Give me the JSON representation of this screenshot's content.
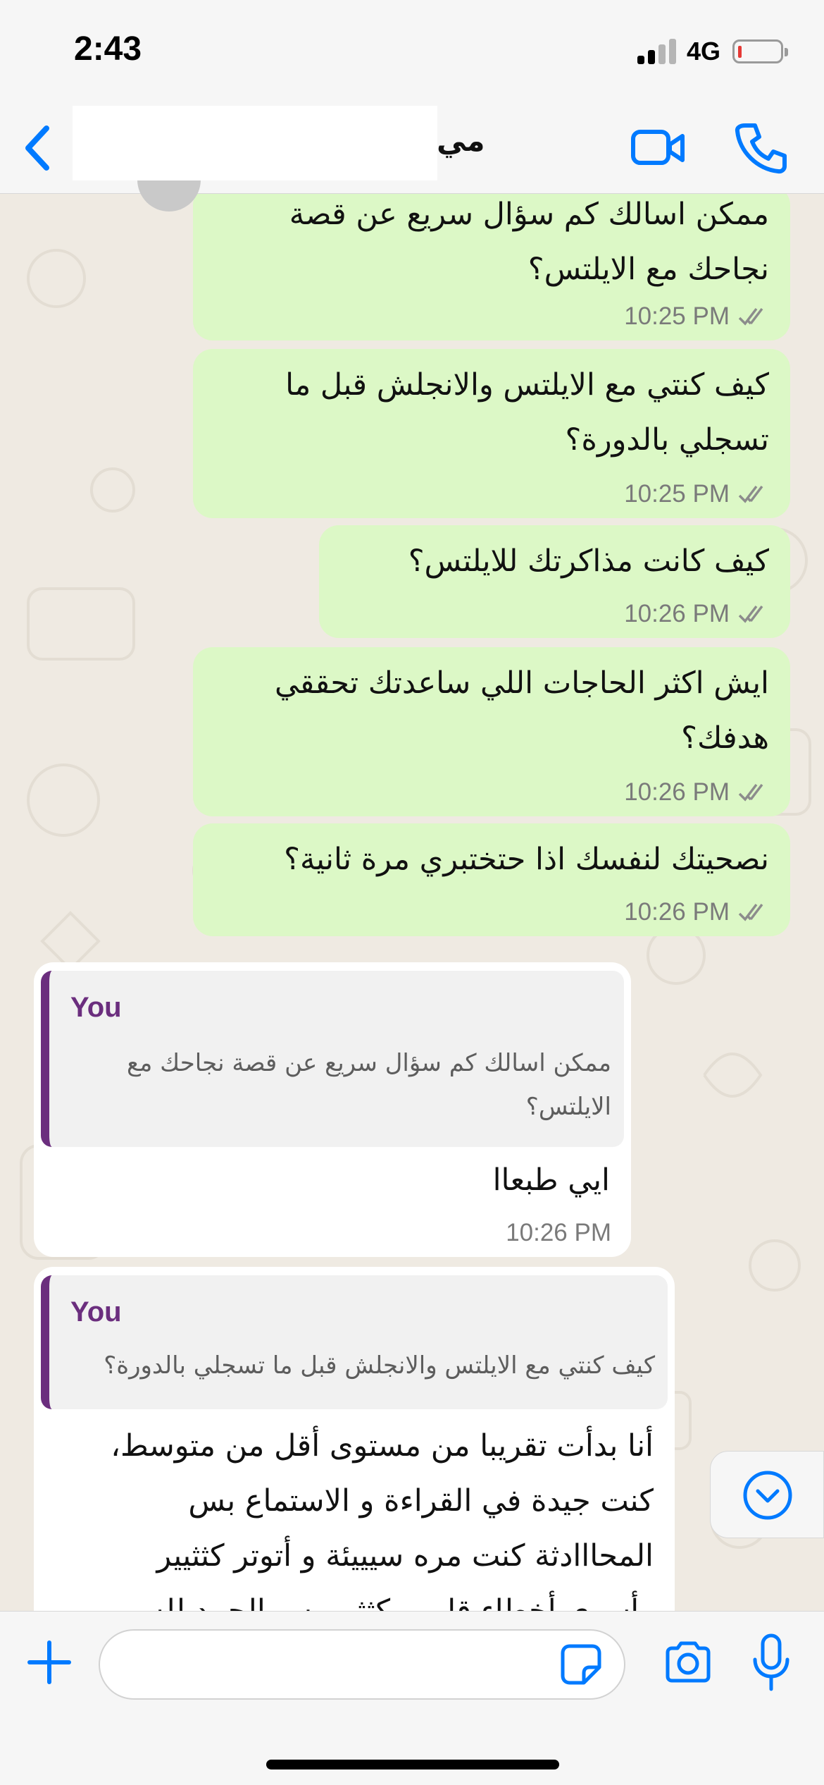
{
  "status_bar": {
    "time": "2:43",
    "network": "4G",
    "battery_level": 0.08
  },
  "header": {
    "contact_name": "مي",
    "accent_color": "#007aff"
  },
  "messages": [
    {
      "direction": "outgoing",
      "lines": [
        "ممكن اسالك كم سؤال سريع عن قصة",
        "نجاحك مع الايلتس؟"
      ],
      "time": "10:25 PM",
      "status": "read"
    },
    {
      "direction": "outgoing",
      "lines": [
        "كيف كنتي مع الايلتس والانجلش قبل ما",
        "تسجلي بالدورة؟"
      ],
      "time": "10:25 PM",
      "status": "read"
    },
    {
      "direction": "outgoing",
      "lines": [
        "كيف كانت مذاكرتك للايلتس؟"
      ],
      "time": "10:26 PM",
      "status": "read"
    },
    {
      "direction": "outgoing",
      "lines": [
        "ايش اكثر الحاجات اللي ساعدتك تحققي",
        "هدفك؟"
      ],
      "time": "10:26 PM",
      "status": "read"
    },
    {
      "direction": "outgoing",
      "lines": [
        "نصحيتك لنفسك اذا حتختبري مرة ثانية؟"
      ],
      "time": "10:26 PM",
      "status": "read"
    },
    {
      "direction": "incoming",
      "reply_to": {
        "author": "You",
        "lines": [
          "ممكن اسالك كم سؤال سريع عن قصة نجاحك مع",
          "الايلتس؟"
        ]
      },
      "lines": [
        "ايي طبعاا"
      ],
      "time": "10:26 PM"
    },
    {
      "direction": "incoming",
      "reply_to": {
        "author": "You",
        "lines": [
          "كيف كنتي مع الايلتس والانجلش قبل ما تسجلي بالدورة؟"
        ]
      },
      "lines": [
        "أنا بدأت تقريبا من مستوى أقل من متوسط،",
        "كنت جيدة في القراءة و الاستماع بس",
        "المحااادثة كنت مره سيييئة و أتوتر كثثيير",
        "وأسوي أخطاء قارمر كثثير بس الحمد لله"
      ]
    }
  ],
  "input_bar": {
    "placeholder": ""
  },
  "colors": {
    "outgoing_bubble": "#dcf8c6",
    "incoming_bubble": "#ffffff",
    "reply_author": "#6b2e7e",
    "read_ticks": "#8c8c8c"
  },
  "icons": [
    "back-chevron-icon",
    "video-call-icon",
    "phone-icon",
    "scroll-down-icon",
    "plus-icon",
    "sticker-icon",
    "camera-icon",
    "microphone-icon"
  ]
}
